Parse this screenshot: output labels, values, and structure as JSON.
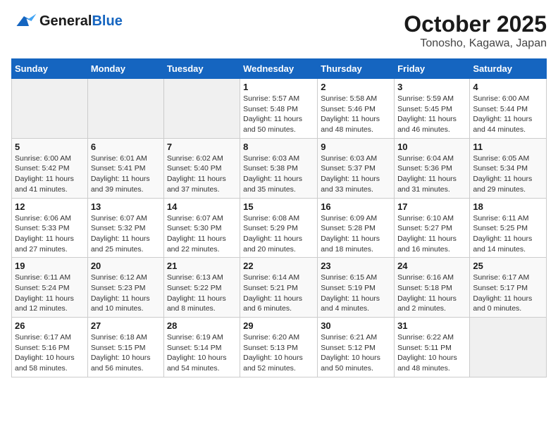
{
  "header": {
    "logo_line1": "General",
    "logo_line2": "Blue",
    "title": "October 2025",
    "subtitle": "Tonosho, Kagawa, Japan"
  },
  "calendar": {
    "days_of_week": [
      "Sunday",
      "Monday",
      "Tuesday",
      "Wednesday",
      "Thursday",
      "Friday",
      "Saturday"
    ],
    "weeks": [
      [
        {
          "day": "",
          "info": ""
        },
        {
          "day": "",
          "info": ""
        },
        {
          "day": "",
          "info": ""
        },
        {
          "day": "1",
          "info": "Sunrise: 5:57 AM\nSunset: 5:48 PM\nDaylight: 11 hours and 50 minutes."
        },
        {
          "day": "2",
          "info": "Sunrise: 5:58 AM\nSunset: 5:46 PM\nDaylight: 11 hours and 48 minutes."
        },
        {
          "day": "3",
          "info": "Sunrise: 5:59 AM\nSunset: 5:45 PM\nDaylight: 11 hours and 46 minutes."
        },
        {
          "day": "4",
          "info": "Sunrise: 6:00 AM\nSunset: 5:44 PM\nDaylight: 11 hours and 44 minutes."
        }
      ],
      [
        {
          "day": "5",
          "info": "Sunrise: 6:00 AM\nSunset: 5:42 PM\nDaylight: 11 hours and 41 minutes."
        },
        {
          "day": "6",
          "info": "Sunrise: 6:01 AM\nSunset: 5:41 PM\nDaylight: 11 hours and 39 minutes."
        },
        {
          "day": "7",
          "info": "Sunrise: 6:02 AM\nSunset: 5:40 PM\nDaylight: 11 hours and 37 minutes."
        },
        {
          "day": "8",
          "info": "Sunrise: 6:03 AM\nSunset: 5:38 PM\nDaylight: 11 hours and 35 minutes."
        },
        {
          "day": "9",
          "info": "Sunrise: 6:03 AM\nSunset: 5:37 PM\nDaylight: 11 hours and 33 minutes."
        },
        {
          "day": "10",
          "info": "Sunrise: 6:04 AM\nSunset: 5:36 PM\nDaylight: 11 hours and 31 minutes."
        },
        {
          "day": "11",
          "info": "Sunrise: 6:05 AM\nSunset: 5:34 PM\nDaylight: 11 hours and 29 minutes."
        }
      ],
      [
        {
          "day": "12",
          "info": "Sunrise: 6:06 AM\nSunset: 5:33 PM\nDaylight: 11 hours and 27 minutes."
        },
        {
          "day": "13",
          "info": "Sunrise: 6:07 AM\nSunset: 5:32 PM\nDaylight: 11 hours and 25 minutes."
        },
        {
          "day": "14",
          "info": "Sunrise: 6:07 AM\nSunset: 5:30 PM\nDaylight: 11 hours and 22 minutes."
        },
        {
          "day": "15",
          "info": "Sunrise: 6:08 AM\nSunset: 5:29 PM\nDaylight: 11 hours and 20 minutes."
        },
        {
          "day": "16",
          "info": "Sunrise: 6:09 AM\nSunset: 5:28 PM\nDaylight: 11 hours and 18 minutes."
        },
        {
          "day": "17",
          "info": "Sunrise: 6:10 AM\nSunset: 5:27 PM\nDaylight: 11 hours and 16 minutes."
        },
        {
          "day": "18",
          "info": "Sunrise: 6:11 AM\nSunset: 5:25 PM\nDaylight: 11 hours and 14 minutes."
        }
      ],
      [
        {
          "day": "19",
          "info": "Sunrise: 6:11 AM\nSunset: 5:24 PM\nDaylight: 11 hours and 12 minutes."
        },
        {
          "day": "20",
          "info": "Sunrise: 6:12 AM\nSunset: 5:23 PM\nDaylight: 11 hours and 10 minutes."
        },
        {
          "day": "21",
          "info": "Sunrise: 6:13 AM\nSunset: 5:22 PM\nDaylight: 11 hours and 8 minutes."
        },
        {
          "day": "22",
          "info": "Sunrise: 6:14 AM\nSunset: 5:21 PM\nDaylight: 11 hours and 6 minutes."
        },
        {
          "day": "23",
          "info": "Sunrise: 6:15 AM\nSunset: 5:19 PM\nDaylight: 11 hours and 4 minutes."
        },
        {
          "day": "24",
          "info": "Sunrise: 6:16 AM\nSunset: 5:18 PM\nDaylight: 11 hours and 2 minutes."
        },
        {
          "day": "25",
          "info": "Sunrise: 6:17 AM\nSunset: 5:17 PM\nDaylight: 11 hours and 0 minutes."
        }
      ],
      [
        {
          "day": "26",
          "info": "Sunrise: 6:17 AM\nSunset: 5:16 PM\nDaylight: 10 hours and 58 minutes."
        },
        {
          "day": "27",
          "info": "Sunrise: 6:18 AM\nSunset: 5:15 PM\nDaylight: 10 hours and 56 minutes."
        },
        {
          "day": "28",
          "info": "Sunrise: 6:19 AM\nSunset: 5:14 PM\nDaylight: 10 hours and 54 minutes."
        },
        {
          "day": "29",
          "info": "Sunrise: 6:20 AM\nSunset: 5:13 PM\nDaylight: 10 hours and 52 minutes."
        },
        {
          "day": "30",
          "info": "Sunrise: 6:21 AM\nSunset: 5:12 PM\nDaylight: 10 hours and 50 minutes."
        },
        {
          "day": "31",
          "info": "Sunrise: 6:22 AM\nSunset: 5:11 PM\nDaylight: 10 hours and 48 minutes."
        },
        {
          "day": "",
          "info": ""
        }
      ]
    ]
  }
}
